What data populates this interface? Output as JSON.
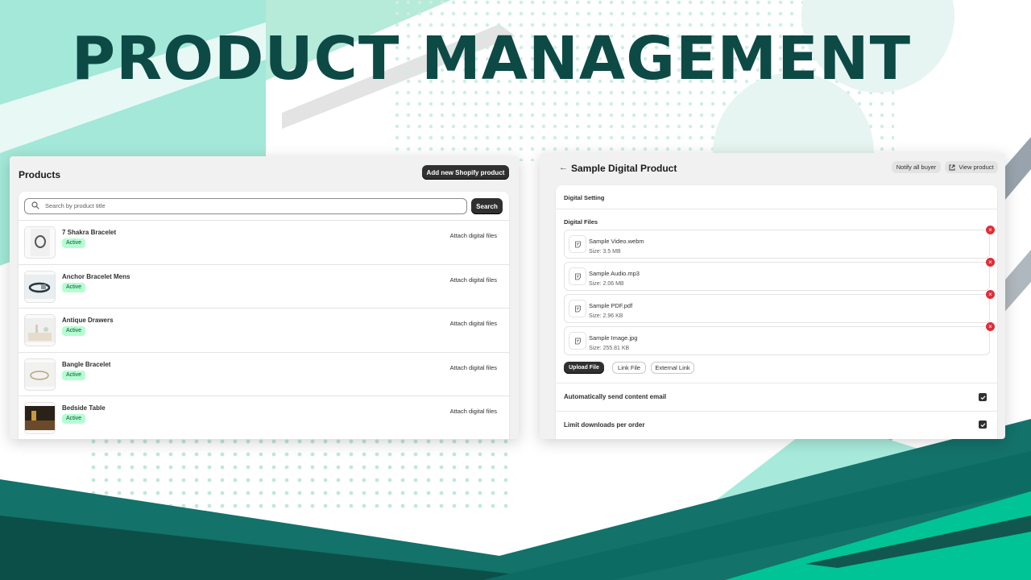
{
  "hero": {
    "title": "PRODUCT MANAGEMENT"
  },
  "colors": {
    "dark_teal": "#0d4a45",
    "mint": "#a3e8d8",
    "teal": "#0f7d6e",
    "green": "#00c495",
    "badge_bg": "#b4fed2",
    "badge_text": "#0c5132",
    "danger": "#e22c38"
  },
  "products_panel": {
    "title": "Products",
    "add_button": "Add new Shopify product",
    "search": {
      "placeholder": "Search by product title",
      "button": "Search"
    },
    "items": [
      {
        "title": "7 Shakra Bracelet",
        "status": "Active",
        "action": "Attach digital files",
        "thumb_icon": "bracelet-thumbnail"
      },
      {
        "title": "Anchor Bracelet Mens",
        "status": "Active",
        "action": "Attach digital files",
        "thumb_icon": "anchor-bracelet-thumbnail"
      },
      {
        "title": "Antique Drawers",
        "status": "Active",
        "action": "Attach digital files",
        "thumb_icon": "drawers-thumbnail"
      },
      {
        "title": "Bangle Bracelet",
        "status": "Active",
        "action": "Attach digital files",
        "thumb_icon": "bangle-thumbnail"
      },
      {
        "title": "Bedside Table",
        "status": "Active",
        "action": "Attach digital files",
        "thumb_icon": "table-thumbnail"
      }
    ]
  },
  "digital_panel": {
    "back_icon": "arrow-left-icon",
    "title": "Sample Digital Product",
    "notify_button": "Notify all buyer",
    "view_button": "View product",
    "section_title": "Digital Setting",
    "files_label": "Digital Files",
    "files": [
      {
        "name": "Sample Video.webm",
        "size": "Size: 3.5 MB"
      },
      {
        "name": "Sample Audio.mp3",
        "size": "Size: 2.06 MB"
      },
      {
        "name": "Sample PDF.pdf",
        "size": "Size: 2.96 KB"
      },
      {
        "name": "Sample Image.jpg",
        "size": "Size: 255.81 KB"
      }
    ],
    "upload_button": "Upload File",
    "link_button": "Link File",
    "external_button": "External Link",
    "options": [
      {
        "label": "Automatically send content email",
        "checked": true
      },
      {
        "label": "Limit downloads per order",
        "checked": true
      }
    ]
  }
}
